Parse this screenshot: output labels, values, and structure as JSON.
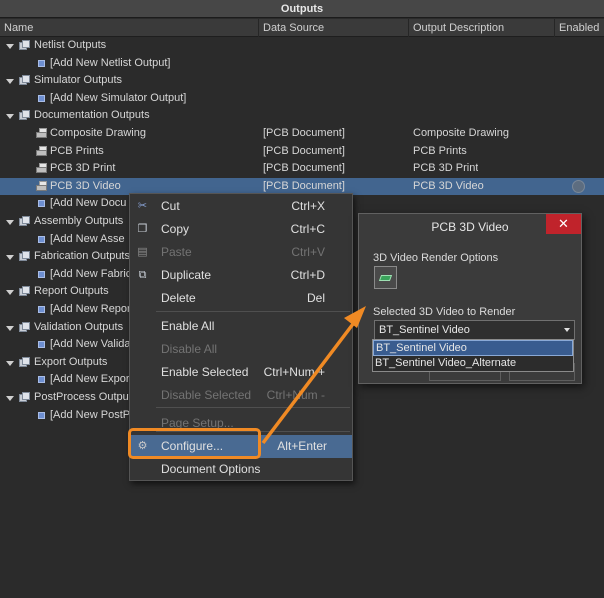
{
  "panel": {
    "title": "Outputs"
  },
  "columns": [
    "Name",
    "Data Source",
    "Output Description",
    "Enabled"
  ],
  "tree_rows": [
    {
      "type": "group",
      "label": "Netlist Outputs"
    },
    {
      "type": "add",
      "label": "[Add New Netlist Output]"
    },
    {
      "type": "group",
      "label": "Simulator Outputs"
    },
    {
      "type": "add",
      "label": "[Add New Simulator Output]"
    },
    {
      "type": "group",
      "label": "Documentation Outputs"
    },
    {
      "type": "doc",
      "label": "Composite Drawing",
      "source": "[PCB Document]",
      "description": "Composite Drawing"
    },
    {
      "type": "doc",
      "label": "PCB Prints",
      "source": "[PCB Document]",
      "description": "PCB Prints"
    },
    {
      "type": "doc",
      "label": "PCB 3D Print",
      "source": "[PCB Document]",
      "description": "PCB 3D Print"
    },
    {
      "type": "doc",
      "label": "PCB 3D Video",
      "source": "[PCB Document]",
      "description": "PCB 3D Video",
      "selected": true
    },
    {
      "type": "add",
      "label": "[Add New Docu"
    },
    {
      "type": "group",
      "label": "Assembly Outputs"
    },
    {
      "type": "add",
      "label": "[Add New Asse"
    },
    {
      "type": "group",
      "label": "Fabrication Outputs"
    },
    {
      "type": "add",
      "label": "[Add New Fabric"
    },
    {
      "type": "group",
      "label": "Report Outputs"
    },
    {
      "type": "add",
      "label": "[Add New Repor"
    },
    {
      "type": "group",
      "label": "Validation Outputs"
    },
    {
      "type": "add",
      "label": "[Add New Valida"
    },
    {
      "type": "group",
      "label": "Export Outputs"
    },
    {
      "type": "add",
      "label": "[Add New Expor"
    },
    {
      "type": "group",
      "label": "PostProcess Output"
    },
    {
      "type": "add",
      "label": "[Add New PostP"
    }
  ],
  "context_menu": {
    "items": [
      {
        "label": "Cut",
        "shortcut": "Ctrl+X",
        "icon": "scissors-icon",
        "disabled": false
      },
      {
        "label": "Copy",
        "shortcut": "Ctrl+C",
        "icon": "copy-icon",
        "disabled": false
      },
      {
        "label": "Paste",
        "shortcut": "Ctrl+V",
        "icon": "paste-icon",
        "disabled": true
      },
      {
        "label": "Duplicate",
        "shortcut": "Ctrl+D",
        "icon": "duplicate-icon",
        "disabled": false
      },
      {
        "label": "Delete",
        "shortcut": "Del",
        "icon": "",
        "disabled": false
      },
      {
        "label": "Enable All",
        "shortcut": "",
        "icon": "",
        "disabled": false
      },
      {
        "label": "Disable All",
        "shortcut": "",
        "icon": "",
        "disabled": true
      },
      {
        "label": "Enable Selected",
        "shortcut": "Ctrl+Num +",
        "icon": "",
        "disabled": false
      },
      {
        "label": "Disable Selected",
        "shortcut": "Ctrl+Num -",
        "icon": "",
        "disabled": true
      },
      {
        "label": "Page Setup...",
        "shortcut": "",
        "icon": "",
        "disabled": true
      },
      {
        "label": "Configure...",
        "shortcut": "Alt+Enter",
        "icon": "configure-icon",
        "disabled": false,
        "highlighted": true
      },
      {
        "label": "Document Options",
        "shortcut": "",
        "icon": "",
        "disabled": false
      }
    ]
  },
  "dialog": {
    "title": "PCB 3D Video",
    "close_label": "✕",
    "render_options_label": "3D Video Render Options",
    "selected_video_label": "Selected 3D Video to Render",
    "selected_value": "BT_Sentinel Video",
    "options": [
      "BT_Sentinel Video",
      "BT_Sentinel Video_Alternate"
    ]
  },
  "colors": {
    "highlight": "#f08a24",
    "selection": "#42658f",
    "close_button": "#c0232b"
  }
}
